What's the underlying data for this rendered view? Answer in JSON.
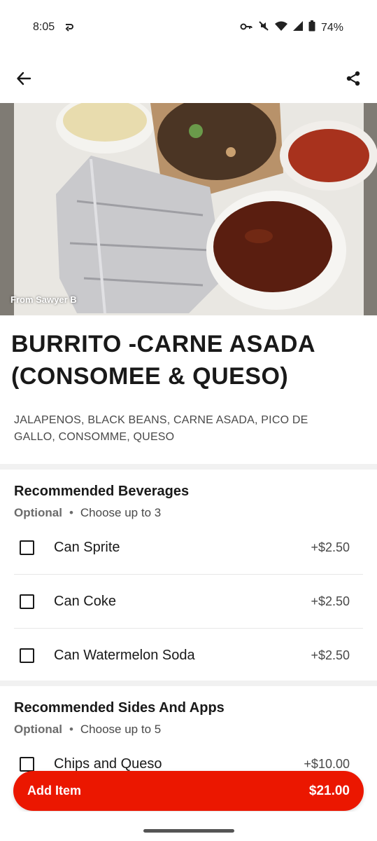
{
  "status_bar": {
    "time": "8:05",
    "battery": "74%",
    "icons": [
      "cast-icon",
      "key-icon",
      "mute-icon",
      "wifi-icon",
      "signal-icon",
      "battery-icon"
    ]
  },
  "header": {
    "back_icon": "arrow-left-icon",
    "share_icon": "share-icon"
  },
  "hero": {
    "photo_credit": "From Sawyer B"
  },
  "item": {
    "title": "BURRITO -CARNE ASADA (CONSOMEE & QUESO)",
    "description": "JALAPENOS, BLACK BEANS, CARNE ASADA, PICO DE GALLO, CONSOMME, QUESO"
  },
  "sections": [
    {
      "title": "Recommended Beverages",
      "optional": "Optional",
      "dot": "•",
      "rule": "Choose up to 3",
      "options": [
        {
          "label": "Can Sprite",
          "price": "+$2.50"
        },
        {
          "label": "Can Coke",
          "price": "+$2.50"
        },
        {
          "label": "Can Watermelon Soda",
          "price": "+$2.50"
        }
      ]
    },
    {
      "title": "Recommended Sides And Apps",
      "optional": "Optional",
      "dot": "•",
      "rule": "Choose up to 5",
      "options": [
        {
          "label": "Chips and Queso",
          "price": "+$10.00"
        }
      ]
    }
  ],
  "cart": {
    "button_label": "Add Item",
    "total": "$21.00"
  },
  "colors": {
    "brand": "#eb1700",
    "text": "#191919",
    "muted": "#494949"
  }
}
